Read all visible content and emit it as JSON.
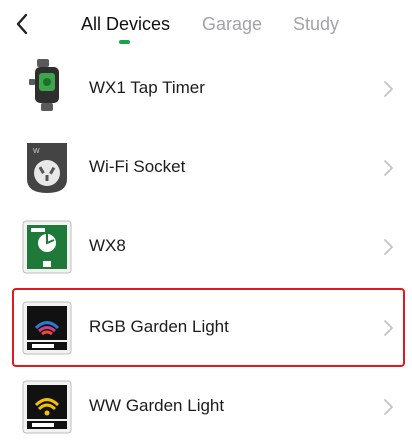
{
  "tabs": [
    {
      "label": "All Devices"
    },
    {
      "label": "Garage"
    },
    {
      "label": "Study"
    }
  ],
  "devices": [
    {
      "name": "WX1 Tap Timer",
      "icon": "tap-timer-icon"
    },
    {
      "name": "Wi-Fi Socket",
      "icon": "wifi-socket-icon"
    },
    {
      "name": "WX8",
      "icon": "wx8-controller-icon"
    },
    {
      "name": "RGB Garden Light",
      "icon": "rgb-light-icon"
    },
    {
      "name": "WW Garden Light",
      "icon": "ww-light-icon"
    }
  ],
  "colors": {
    "accent": "#1aa34a",
    "highlight": "#e0191e",
    "inactive_tab": "#a3a3a8"
  },
  "selected_device_index": 3
}
